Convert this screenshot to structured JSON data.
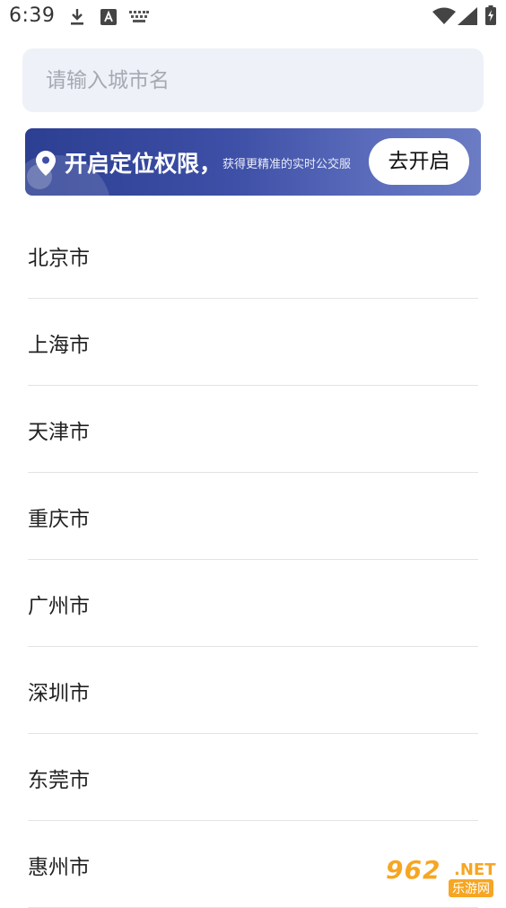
{
  "status_bar": {
    "time": "6:39",
    "icons": [
      "download-icon",
      "font-a-icon",
      "keyboard-icon",
      "wifi-icon",
      "signal-icon",
      "battery-charging-icon"
    ]
  },
  "search": {
    "placeholder": "请输入城市名",
    "value": ""
  },
  "location_banner": {
    "title": "开启定位权限，",
    "subtitle": "获得更精准的实时公交服",
    "button_label": "去开启",
    "icon": "location-pin-icon",
    "colors": {
      "start": "#2c3f92",
      "end": "#6b7cc4"
    }
  },
  "cities": [
    "北京市",
    "上海市",
    "天津市",
    "重庆市",
    "广州市",
    "深圳市",
    "东莞市",
    "惠州市"
  ],
  "watermark": {
    "main": "962",
    "suffix": ".NET",
    "sub": "乐游网"
  }
}
